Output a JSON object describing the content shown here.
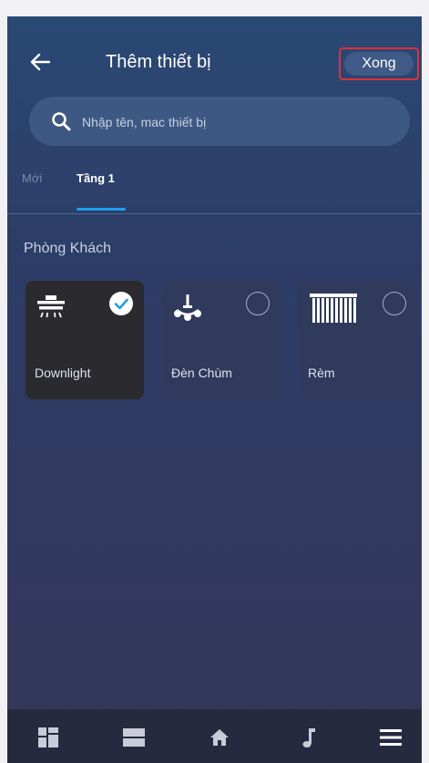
{
  "header": {
    "back_icon": "arrow-left-icon",
    "title": "Thêm thiết bị",
    "done_label": "Xong",
    "done_highlight_color": "#e03038"
  },
  "search": {
    "icon": "search-icon",
    "placeholder": "Nhập tên, mac thiết bị"
  },
  "tabs": [
    {
      "label": "Mới",
      "selected": false
    },
    {
      "label": "Tầng 1",
      "selected": true
    }
  ],
  "room": {
    "name": "Phòng Khách",
    "devices": [
      {
        "label": "Downlight",
        "icon": "downlight-icon",
        "selected": true
      },
      {
        "label": "Đèn Chùm",
        "icon": "chandelier-icon",
        "selected": false
      },
      {
        "label": "Rèm",
        "icon": "curtain-icon",
        "selected": false
      }
    ]
  },
  "bottom_nav": [
    {
      "icon": "dashboard-grid-icon"
    },
    {
      "icon": "list-rows-icon"
    },
    {
      "icon": "home-icon"
    },
    {
      "icon": "music-note-icon"
    },
    {
      "icon": "menu-icon"
    }
  ],
  "colors": {
    "accent": "#1ea0f2",
    "selected_card": "#2b2b2f",
    "card": "#2f3a5c",
    "nav_background": "#262a3f"
  }
}
